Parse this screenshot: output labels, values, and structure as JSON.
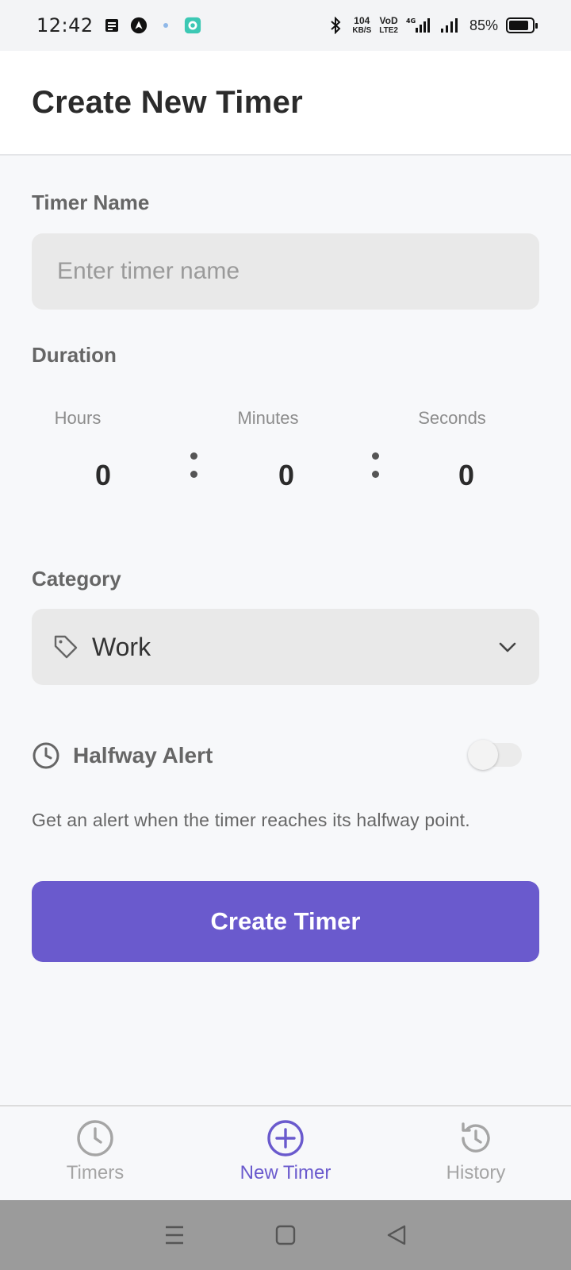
{
  "status_bar": {
    "time": "12:42",
    "net_speed_top": "104",
    "net_speed_bottom": "KB/S",
    "volte_top": "VoD",
    "volte_bottom": "LTE2",
    "network": "4G",
    "battery_percent": "85%",
    "battery_level": 0.85,
    "icons": [
      "notes-icon",
      "nav-app-icon",
      "dot-icon",
      "chat-app-icon",
      "bluetooth-icon",
      "signal-icon",
      "signal-icon",
      "battery-icon"
    ]
  },
  "header": {
    "title": "Create New Timer"
  },
  "form": {
    "name_label": "Timer Name",
    "name_placeholder": "Enter timer name",
    "name_value": "",
    "duration_label": "Duration",
    "hours_label": "Hours",
    "hours_value": "0",
    "minutes_label": "Minutes",
    "minutes_value": "0",
    "seconds_label": "Seconds",
    "seconds_value": "0",
    "category_label": "Category",
    "category_value": "Work",
    "halfway_label": "Halfway Alert",
    "halfway_enabled": false,
    "halfway_help": "Get an alert when the timer reaches its halfway point.",
    "submit_label": "Create Timer"
  },
  "bottom_nav": {
    "items": [
      {
        "label": "Timers",
        "icon": "clock-icon",
        "active": false
      },
      {
        "label": "New Timer",
        "icon": "plus-circle-icon",
        "active": true
      },
      {
        "label": "History",
        "icon": "history-icon",
        "active": false
      }
    ]
  },
  "colors": {
    "accent": "#6a5acd",
    "inactive": "#a5a5a5",
    "field_bg": "#e9e9e9"
  }
}
